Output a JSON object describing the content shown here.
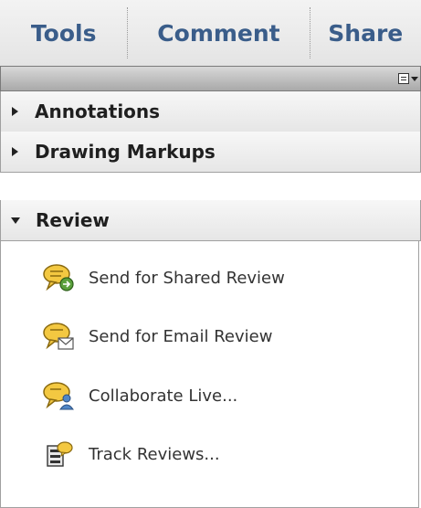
{
  "tabs": [
    {
      "label": "Tools"
    },
    {
      "label": "Comment"
    },
    {
      "label": "Share"
    }
  ],
  "sections": [
    {
      "label": "Annotations",
      "expanded": false
    },
    {
      "label": "Drawing Markups",
      "expanded": false
    },
    {
      "label": "Review",
      "expanded": true
    }
  ],
  "review_items": [
    {
      "label": "Send for Shared Review",
      "icon": "shared-review-icon"
    },
    {
      "label": "Send for Email Review",
      "icon": "email-review-icon"
    },
    {
      "label": "Collaborate Live...",
      "icon": "collaborate-live-icon"
    },
    {
      "label": "Track Reviews...",
      "icon": "track-reviews-icon"
    }
  ],
  "colors": {
    "tab_text": "#3a5d8a",
    "bubble": "#f3c841"
  }
}
